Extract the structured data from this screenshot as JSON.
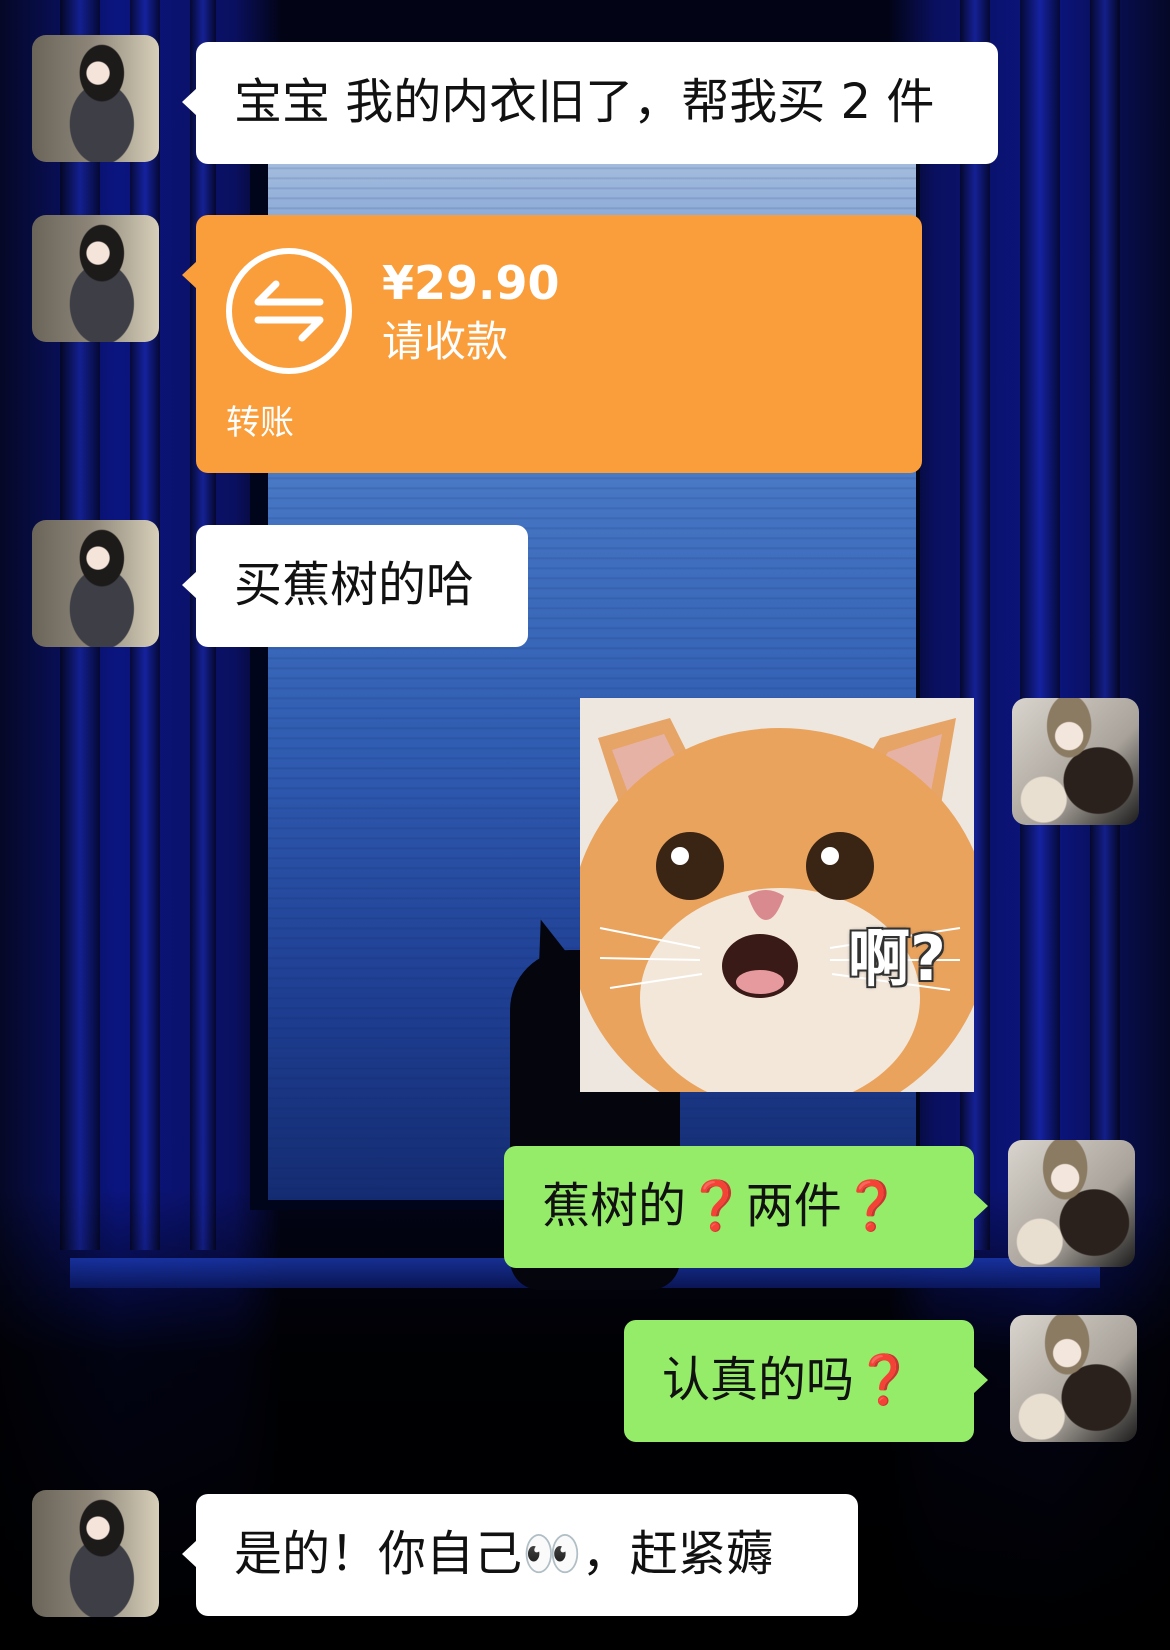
{
  "messages": [
    {
      "side": "left",
      "type": "text",
      "text": "宝宝 我的内衣旧了，帮我买 2 件"
    },
    {
      "side": "left",
      "type": "transfer",
      "amount": "¥29.90",
      "status": "请收款",
      "label": "转账"
    },
    {
      "side": "left",
      "type": "text",
      "text": "买蕉树的哈"
    },
    {
      "side": "right",
      "type": "sticker",
      "caption": "啊?"
    },
    {
      "side": "right",
      "type": "text",
      "parts": [
        "蕉树的",
        "❓",
        "两件",
        "❓"
      ]
    },
    {
      "side": "right",
      "type": "text",
      "parts": [
        "认真的吗",
        "❓"
      ]
    },
    {
      "side": "left",
      "type": "text",
      "parts": [
        "是的！你自己",
        "👀",
        "，赶紧薅"
      ]
    }
  ],
  "colors": {
    "incoming_bubble": "#ffffff",
    "outgoing_bubble": "#95ec69",
    "transfer_card": "#fa9d3b",
    "question_mark": "#e0171f"
  },
  "icons": {
    "transfer": "transfer-arrows-icon",
    "avatar_left": "female-avatar",
    "avatar_right": "female-avatar-with-toy"
  }
}
